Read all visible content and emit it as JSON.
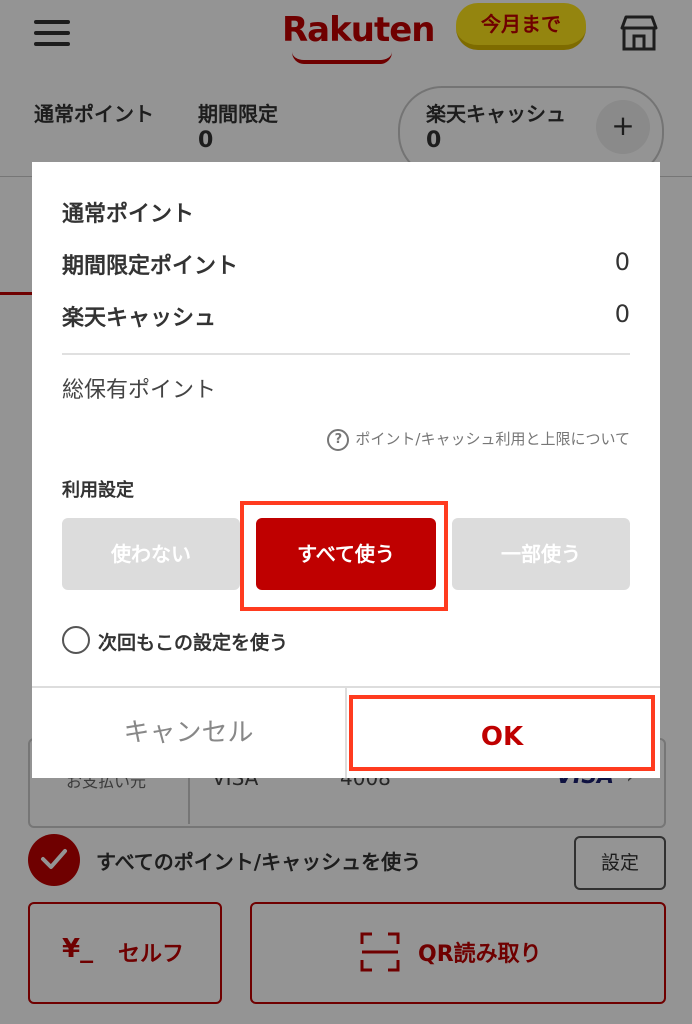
{
  "header": {
    "logo": "Rakuten",
    "promo_badge": "今月まで",
    "menu_icon": "hamburger-menu-icon",
    "store_icon": "store-icon"
  },
  "points_bar": {
    "regular_label": "通常ポイント",
    "limited_label": "期間限定",
    "limited_value": "0",
    "cash_label": "楽天キャッシュ",
    "cash_value": "0",
    "add_icon": "plus-icon"
  },
  "payment": {
    "label": "お支払い元",
    "card_brand_text": "VISA",
    "card_last4": "4008",
    "brand_logo": "VISA",
    "chevron": "›"
  },
  "use_all": {
    "label": "すべてのポイント/キャッシュを使う",
    "settings_label": "設定"
  },
  "actions": {
    "self_icon": "¥_",
    "self_label": "セルフ",
    "qr_label": "QR読み取り"
  },
  "dialog": {
    "rows": [
      {
        "label": "通常ポイント",
        "value": ""
      },
      {
        "label": "期間限定ポイント",
        "value": "0"
      },
      {
        "label": "楽天キャッシュ",
        "value": "0"
      }
    ],
    "total_label": "総保有ポイント",
    "help_text": "ポイント/キャッシュ利用と上限について",
    "usage_label": "利用設定",
    "options": [
      "使わない",
      "すべて使う",
      "一部使う"
    ],
    "selected_option": "すべて使う",
    "remember_label": "次回もこの設定を使う",
    "cancel_label": "キャンセル",
    "ok_label": "OK"
  },
  "colors": {
    "brand_red": "#bf0000",
    "highlight": "#ff3b1f",
    "promo_yellow": "#ffe51a",
    "option_gray": "#dcdcdc"
  }
}
